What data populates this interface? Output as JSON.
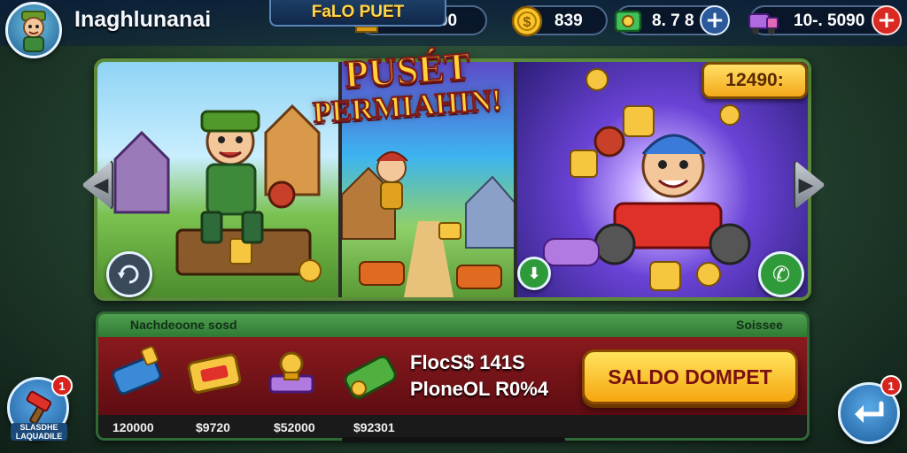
{
  "header": {
    "player_name": "Inaghlunanai",
    "currencies": [
      {
        "icon": "gold-bar-icon",
        "value": "2.0000"
      },
      {
        "icon": "gold-coin-icon",
        "value": "839"
      },
      {
        "icon": "green-gem-icon",
        "value": "8. 7 8"
      },
      {
        "icon": "purple-truck-icon",
        "value": "10-. 5090"
      }
    ]
  },
  "carousel": {
    "promo_title_line1": "PUSÉT",
    "promo_title_line2": "PERMIAHIN!",
    "price_tag": "12490:"
  },
  "shop": {
    "header_left": "Nachdeoone sosd",
    "header_right": "Soissee",
    "tab_title": "FaLO PUET",
    "items": [
      {
        "icon": "blue-battery-icon",
        "price": "120000"
      },
      {
        "icon": "gold-ticket-icon",
        "price": "$9720"
      },
      {
        "icon": "treasure-scale-icon",
        "price": "$52000"
      },
      {
        "icon": "green-cannon-icon",
        "price": "$92301"
      }
    ],
    "offer_line1": "FlocS$ 141S",
    "offer_line2": "PloneOL R0%4",
    "saldo_button": "SALDO DOMPET"
  },
  "bottom_left": {
    "notification_count": "1",
    "label": "SLASDHE LAQUADILE"
  },
  "bottom_right": {
    "notification_count": "1"
  },
  "colors": {
    "accent_gold": "#ffd23a",
    "shop_red": "#8a1a1e",
    "panel_green": "#5b8a3a",
    "alert_red": "#d8231f"
  }
}
